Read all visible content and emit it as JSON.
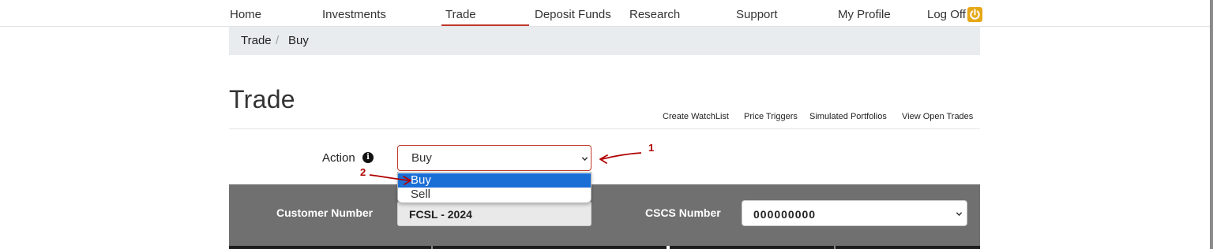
{
  "nav": {
    "items": [
      "Home",
      "Investments",
      "Trade",
      "Deposit Funds",
      "Research",
      "Support",
      "My Profile",
      "Log Off"
    ],
    "active": "Trade"
  },
  "breadcrumb": {
    "items": [
      "Trade",
      "Buy"
    ],
    "separator": "/"
  },
  "page": {
    "title": "Trade",
    "links": [
      "Create WatchList",
      "Price Triggers",
      "Simulated Portfolios",
      "View Open Trades"
    ]
  },
  "action": {
    "label": "Action",
    "selected": "Buy",
    "options": [
      "Buy",
      "Sell"
    ],
    "info_icon": "info-icon"
  },
  "customer": {
    "label": "Customer Number",
    "value": "FCSL - 2024"
  },
  "cscs": {
    "label": "CSCS Number",
    "value": "000000000"
  },
  "annotations": {
    "one": "1",
    "two": "2"
  },
  "colors": {
    "accent": "#c0392b",
    "band": "#707070",
    "selected_option": "#1a6fd6",
    "annotation": "#b00000"
  }
}
